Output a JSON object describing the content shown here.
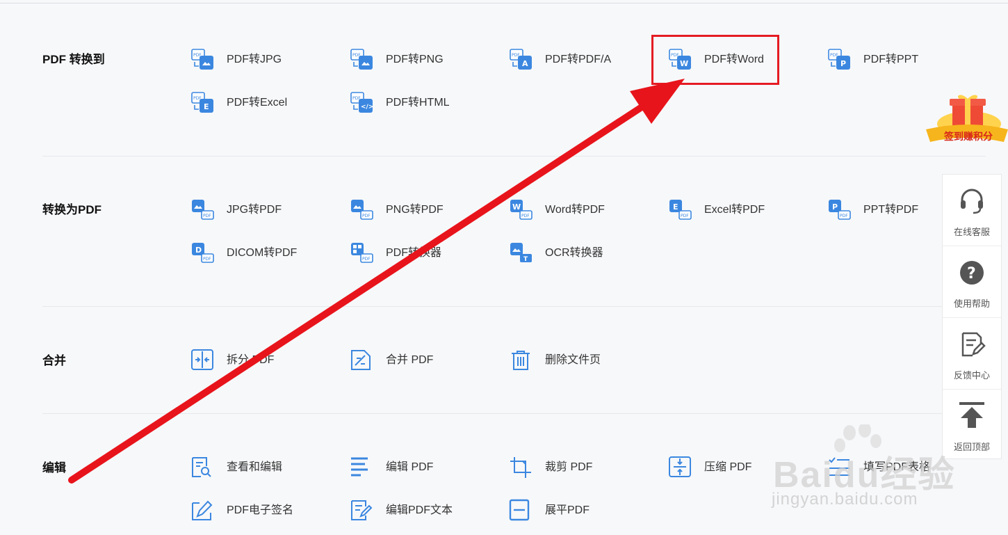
{
  "colors": {
    "accent": "#3b87e0",
    "highlight": "#e51c23",
    "arrow": "#e8141b"
  },
  "sections": [
    {
      "title": "PDF 转换到",
      "tools": [
        {
          "label": "PDF转JPG",
          "icon": "pdf-to-jpg-icon"
        },
        {
          "label": "PDF转PNG",
          "icon": "pdf-to-png-icon"
        },
        {
          "label": "PDF转PDF/A",
          "icon": "pdf-to-pdfa-icon"
        },
        {
          "label": "PDF转Word",
          "icon": "pdf-to-word-icon"
        },
        {
          "label": "PDF转PPT",
          "icon": "pdf-to-ppt-icon"
        },
        {
          "label": "PDF转Excel",
          "icon": "pdf-to-excel-icon"
        },
        {
          "label": "PDF转HTML",
          "icon": "pdf-to-html-icon"
        }
      ]
    },
    {
      "title": "转换为PDF",
      "tools": [
        {
          "label": "JPG转PDF",
          "icon": "jpg-to-pdf-icon"
        },
        {
          "label": "PNG转PDF",
          "icon": "png-to-pdf-icon"
        },
        {
          "label": "Word转PDF",
          "icon": "word-to-pdf-icon"
        },
        {
          "label": "Excel转PDF",
          "icon": "excel-to-pdf-icon"
        },
        {
          "label": "PPT转PDF",
          "icon": "ppt-to-pdf-icon"
        },
        {
          "label": "DICOM转PDF",
          "icon": "dicom-to-pdf-icon"
        },
        {
          "label": "PDF转换器",
          "icon": "pdf-converter-icon"
        },
        {
          "label": "OCR转换器",
          "icon": "ocr-converter-icon"
        }
      ]
    },
    {
      "title": "合并",
      "tools": [
        {
          "label": "拆分 PDF",
          "icon": "split-pdf-icon"
        },
        {
          "label": "合并 PDF",
          "icon": "merge-pdf-icon"
        },
        {
          "label": "删除文件页",
          "icon": "delete-pages-icon"
        }
      ]
    },
    {
      "title": "编辑",
      "tools": [
        {
          "label": "查看和编辑",
          "icon": "view-edit-icon"
        },
        {
          "label": "编辑 PDF",
          "icon": "edit-pdf-icon"
        },
        {
          "label": "裁剪 PDF",
          "icon": "crop-pdf-icon"
        },
        {
          "label": "压缩 PDF",
          "icon": "compress-pdf-icon"
        },
        {
          "label": "填写PDF表格",
          "icon": "fill-form-icon"
        },
        {
          "label": "PDF电子签名",
          "icon": "e-signature-icon"
        },
        {
          "label": "编辑PDF文本",
          "icon": "edit-text-icon"
        },
        {
          "label": "展平PDF",
          "icon": "flatten-pdf-icon"
        }
      ]
    }
  ],
  "side_panel": [
    {
      "label": "在线客服",
      "icon": "headset-icon"
    },
    {
      "label": "使用帮助",
      "icon": "help-icon"
    },
    {
      "label": "反馈中心",
      "icon": "feedback-icon"
    },
    {
      "label": "返回顶部",
      "icon": "back-to-top-icon"
    }
  ],
  "gift_badge": {
    "label": "签到赚积分"
  },
  "watermark": {
    "brand": "Baidu经验",
    "url": "jingyan.baidu.com"
  }
}
